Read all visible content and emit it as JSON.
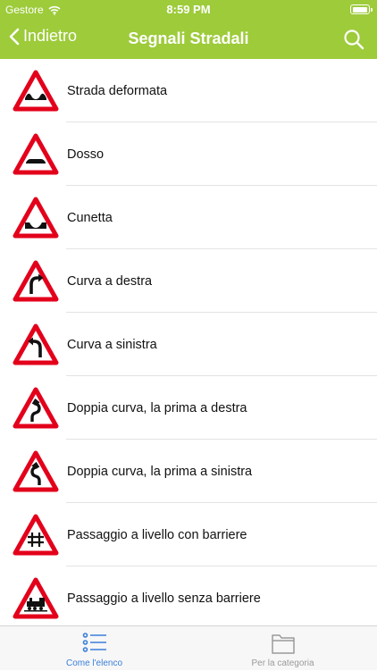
{
  "status_bar": {
    "carrier": "Gestore",
    "time": "8:59 PM"
  },
  "nav": {
    "back_label": "Indietro",
    "title": "Segnali Stradali"
  },
  "signs": [
    {
      "label": "Strada deformata",
      "symbol": "bumpy-road-icon"
    },
    {
      "label": "Dosso",
      "symbol": "speed-bump-icon"
    },
    {
      "label": "Cunetta",
      "symbol": "dip-icon"
    },
    {
      "label": "Curva a destra",
      "symbol": "curve-right-icon"
    },
    {
      "label": "Curva a sinistra",
      "symbol": "curve-left-icon"
    },
    {
      "label": "Doppia curva, la prima a destra",
      "symbol": "double-curve-right-icon"
    },
    {
      "label": "Doppia curva, la prima a sinistra",
      "symbol": "double-curve-left-icon"
    },
    {
      "label": "Passaggio a livello con barriere",
      "symbol": "level-crossing-barrier-icon"
    },
    {
      "label": "Passaggio a livello senza barriere",
      "symbol": "level-crossing-train-icon"
    }
  ],
  "tabs": [
    {
      "label": "Come l'elenco",
      "active": true,
      "icon": "list-icon"
    },
    {
      "label": "Per la categoria",
      "active": false,
      "icon": "folder-icon"
    }
  ],
  "colors": {
    "accent": "#9dcb3a",
    "sign_border": "#e3001b",
    "tab_active": "#3b7fd9",
    "tab_inactive": "#9a9a9a"
  }
}
